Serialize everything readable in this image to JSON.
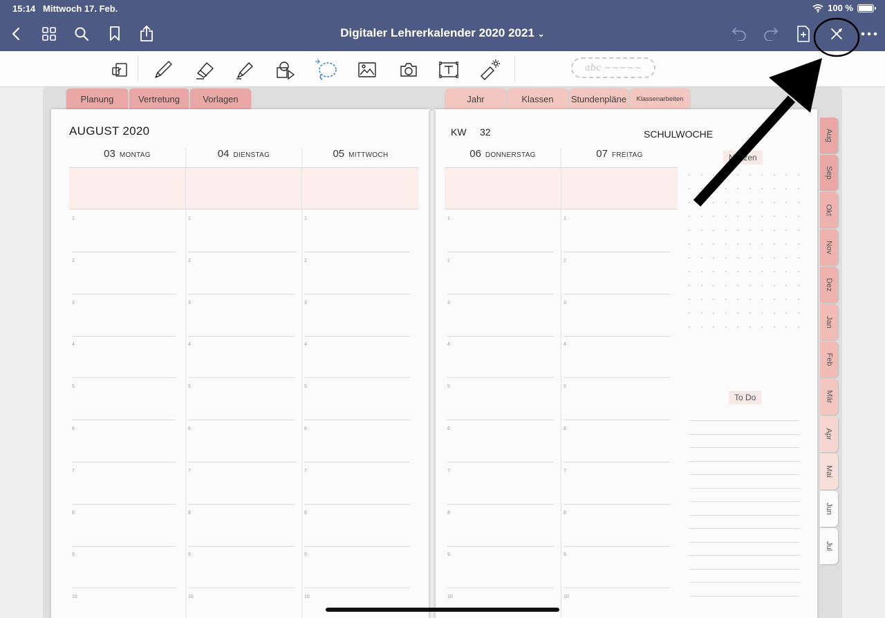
{
  "status_bar": {
    "time": "15:14",
    "date": "Mittwoch 17. Feb.",
    "battery_text": "100 %",
    "battery_level": 1.0
  },
  "nav_bar": {
    "title": "Digitaler Lehrerkalender 2020 2021",
    "title_chevron": "⌄"
  },
  "nav_icons": [
    "back-chevron-icon",
    "thumbnail-grid-icon",
    "search-icon",
    "bookmark-icon",
    "share-icon",
    "undo-icon",
    "redo-icon",
    "add-page-icon",
    "close-toolbar-icon",
    "more-icon"
  ],
  "toolbar": {
    "lasso_hint": "abc ~~~~~"
  },
  "tools": [
    "zoom-window-icon",
    "pen-icon",
    "eraser-icon",
    "highlighter-icon",
    "shapes-icon",
    "lasso-icon",
    "image-icon",
    "camera-icon",
    "text-icon",
    "laser-pointer-icon"
  ],
  "section_tabs_left": [
    "Planung",
    "Vertretung",
    "Vorlagen"
  ],
  "section_tabs_right": [
    "Jahr",
    "Klassen",
    "Stundenpläne",
    "Klassenarbeiten"
  ],
  "planner": {
    "month_title": "AUGUST 2020",
    "kw_label": "KW",
    "kw_number": "32",
    "week_type": "SCHULWOCHE",
    "days": [
      {
        "num": "03",
        "name": "MONTAG"
      },
      {
        "num": "04",
        "name": "DIENSTAG"
      },
      {
        "num": "05",
        "name": "MITTWOCH"
      },
      {
        "num": "06",
        "name": "DONNERSTAG"
      },
      {
        "num": "07",
        "name": "FREITAG"
      }
    ],
    "slots": [
      "1",
      "2",
      "3",
      "4",
      "5",
      "6",
      "7",
      "8",
      "9",
      "10"
    ],
    "notes_label": "Notizen",
    "todo_label": "To Do"
  },
  "month_tabs": [
    "Aug",
    "Sep",
    "Okt",
    "Nov",
    "Dez",
    "Jan",
    "Feb",
    "Mär",
    "Apr",
    "Mai",
    "Jun",
    "Jul"
  ],
  "colors": {
    "nav_bg": "#4d5b84",
    "tab_rose": "#e9a8a6",
    "tab_peach": "#f4c6c0",
    "allday_tint": "#fcefeb",
    "annotation": "#000000"
  }
}
